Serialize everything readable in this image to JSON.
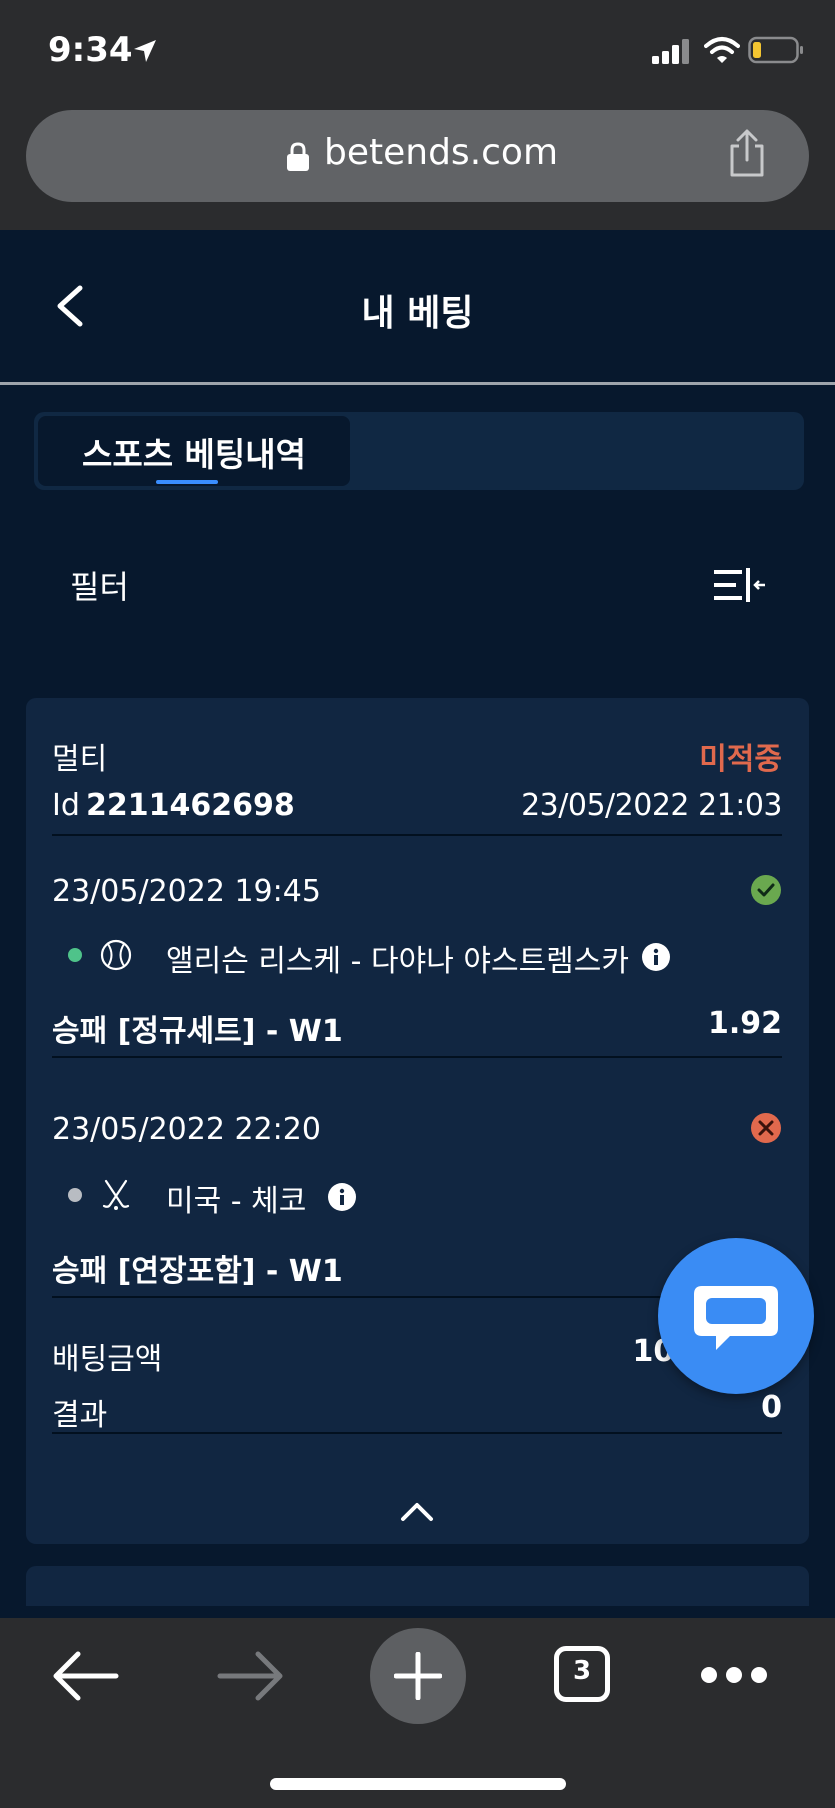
{
  "status_bar": {
    "time": "9:34"
  },
  "browser": {
    "url": "betends.com",
    "open_tabs": "3"
  },
  "header": {
    "title": "내 베팅"
  },
  "tabs": [
    {
      "label": "스포츠 베팅내역",
      "active": true
    }
  ],
  "filter": {
    "label": "필터"
  },
  "bet": {
    "type": "멀티",
    "status": "미적중",
    "id_label": "Id",
    "id": "2211462698",
    "date": "23/05/2022 21:03",
    "events": [
      {
        "date": "23/05/2022 19:45",
        "result": "won",
        "result_icon": "check-circle-icon",
        "live_dot_color": "#4fc38a",
        "sport_icon": "tennis-ball-icon",
        "teams": "앨리슨 리스케 - 다야나 야스트렘스카",
        "market": "승패 [정규세트] - W1",
        "odds": "1.92"
      },
      {
        "date": "23/05/2022 22:20",
        "result": "lost",
        "result_icon": "x-circle-icon",
        "live_dot_color": "#b8bcc2",
        "sport_icon": "hockey-sticks-icon",
        "teams": "미국 - 체코",
        "market": "승패 [연장포함] - W1",
        "odds": ""
      }
    ],
    "stake_label": "배팅금액",
    "stake_value": "10,998 K",
    "result_label": "결과",
    "result_value": "0"
  },
  "colors": {
    "background": "#07182d",
    "card": "#112641",
    "lost": "#e1694d",
    "won": "#6aa84f",
    "accent": "#3a8eff",
    "chat": "#3a8cf4"
  }
}
